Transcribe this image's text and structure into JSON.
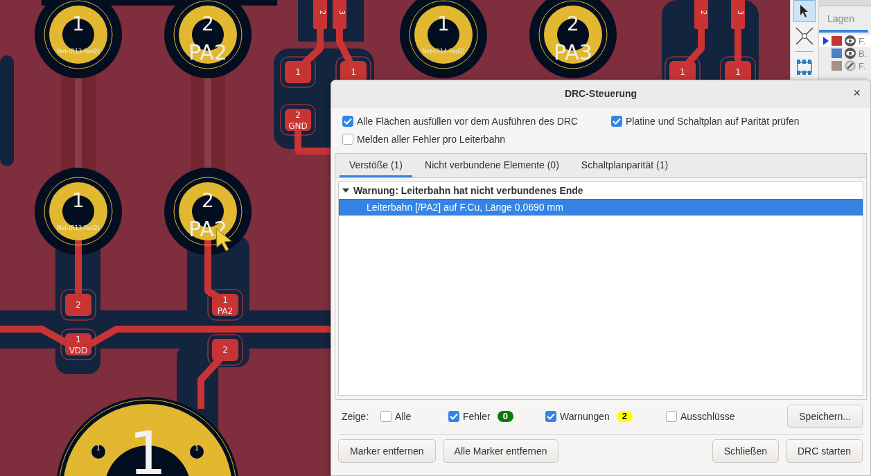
{
  "board": {
    "pads": [
      {
        "kind": "through_hole",
        "number": "1",
        "net": "Net-(R13-Pad2)"
      },
      {
        "kind": "through_hole",
        "number": "2",
        "name": "PA2"
      },
      {
        "kind": "through_hole",
        "number": "1",
        "net": "Net-(R14-Pad2)"
      },
      {
        "kind": "through_hole",
        "number": "2",
        "name": "PA3"
      },
      {
        "kind": "through_hole",
        "number": "1",
        "net": "Net-(R13-Pad2)"
      },
      {
        "kind": "through_hole",
        "number": "2",
        "name": "PA2"
      },
      {
        "kind": "smd",
        "number": "1"
      },
      {
        "kind": "smd",
        "number": "2",
        "name": "GND"
      },
      {
        "kind": "smd",
        "number": "1"
      },
      {
        "kind": "smd",
        "number": "2"
      },
      {
        "kind": "smd",
        "number": "1",
        "name": "VDD"
      },
      {
        "kind": "smd",
        "number": "1",
        "name": "PA2"
      },
      {
        "kind": "smd",
        "number": "2"
      },
      {
        "kind": "smd",
        "number": "1"
      },
      {
        "kind": "smd",
        "number": "1"
      },
      {
        "kind": "smd_vertical",
        "number": "2"
      },
      {
        "kind": "smd_vertical",
        "number": "3"
      },
      {
        "kind": "smd_vertical",
        "number": "2"
      },
      {
        "kind": "smd_vertical",
        "number": "3"
      },
      {
        "kind": "hole",
        "number": "1"
      },
      {
        "kind": "large_hole",
        "number": "1"
      },
      {
        "kind": "hole",
        "number": "1"
      }
    ]
  },
  "toolbar": {
    "tools": [
      {
        "kind": "select",
        "selected": true
      },
      {
        "kind": "cross",
        "selected": false
      },
      {
        "kind": "footprint",
        "selected": false
      }
    ]
  },
  "layers_panel": {
    "tab": "Lagen",
    "layers": [
      {
        "name": "F.",
        "color": "#c83434",
        "visible": true,
        "selected": true
      },
      {
        "name": "B.",
        "color": "#4d7fc4",
        "visible": true,
        "selected": false
      },
      {
        "name": "F.",
        "color": "#a39089",
        "visible": false,
        "selected": false
      }
    ]
  },
  "dialog": {
    "title": "DRC-Steuerung",
    "close": "×",
    "options": [
      {
        "label": "Alle Flächen ausfüllen vor dem Ausführen des DRC",
        "checked": true
      },
      {
        "label": "Platine und Schaltplan auf Parität prüfen",
        "checked": true
      },
      {
        "label": "Melden aller Fehler pro Leiterbahn",
        "checked": false
      }
    ],
    "tabs": [
      {
        "label": "Verstöße (1)",
        "selected": true
      },
      {
        "label": "Nicht verbundene Elemente (0)",
        "selected": false
      },
      {
        "label": "Schaltplanparität (1)",
        "selected": false
      }
    ],
    "violations": [
      {
        "label": "Warnung: Leiterbahn hat nicht verbundenes Ende",
        "expanded": true,
        "children": [
          {
            "label": "Leiterbahn [/PA2] auf F.Cu, Länge 0,0690 mm",
            "selected": true
          }
        ]
      }
    ],
    "filter": {
      "label": "Zeige:",
      "items": [
        {
          "label": "Alle",
          "checked": false
        },
        {
          "label": "Fehler",
          "checked": true,
          "count": "0",
          "color": "#0b7a0b"
        },
        {
          "label": "Warnungen",
          "checked": true,
          "count": "2",
          "color": "#ffff00"
        },
        {
          "label": "Ausschlüsse",
          "checked": false
        }
      ]
    },
    "save_button": "Speichern...",
    "buttons_left": [
      "Marker entfernen",
      "Alle Marker entfernen"
    ],
    "buttons_right": [
      "Schließen",
      "DRC starten"
    ]
  }
}
